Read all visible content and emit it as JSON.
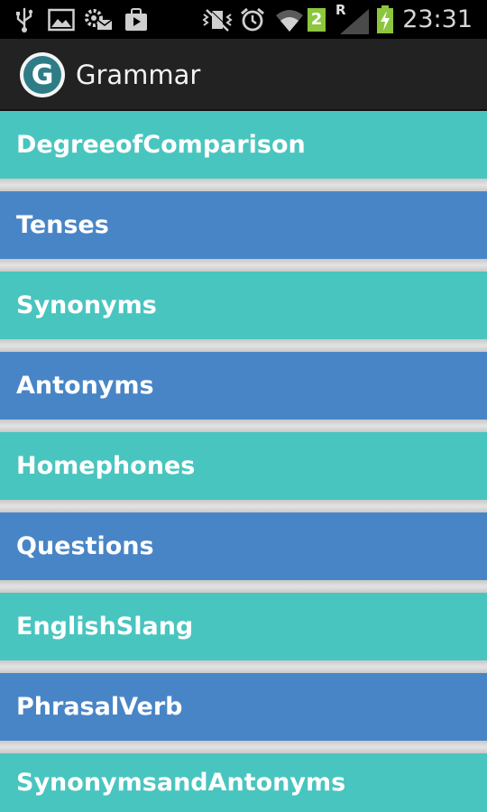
{
  "status_bar": {
    "time": "23:31",
    "sim_badge": "2",
    "roaming_label": "R",
    "icons": [
      "usb-icon",
      "image-icon",
      "settings-mail-icon",
      "media-icon",
      "vibrate-off-icon",
      "alarm-icon",
      "wifi-icon",
      "signal-icon",
      "battery-charging-icon"
    ]
  },
  "action_bar": {
    "title": "Grammar",
    "logo_letter": "G"
  },
  "list": {
    "items": [
      {
        "label": "DegreeofComparison",
        "color": "#49c5bf"
      },
      {
        "label": "Tenses",
        "color": "#4885c6"
      },
      {
        "label": "Synonyms",
        "color": "#49c5bf"
      },
      {
        "label": "Antonyms",
        "color": "#4885c6"
      },
      {
        "label": "Homephones",
        "color": "#49c5bf"
      },
      {
        "label": "Questions",
        "color": "#4885c6"
      },
      {
        "label": "EnglishSlang",
        "color": "#49c5bf"
      },
      {
        "label": "PhrasalVerb",
        "color": "#4885c6"
      },
      {
        "label": "SynonymsandAntonyms",
        "color": "#49c5bf"
      }
    ]
  }
}
